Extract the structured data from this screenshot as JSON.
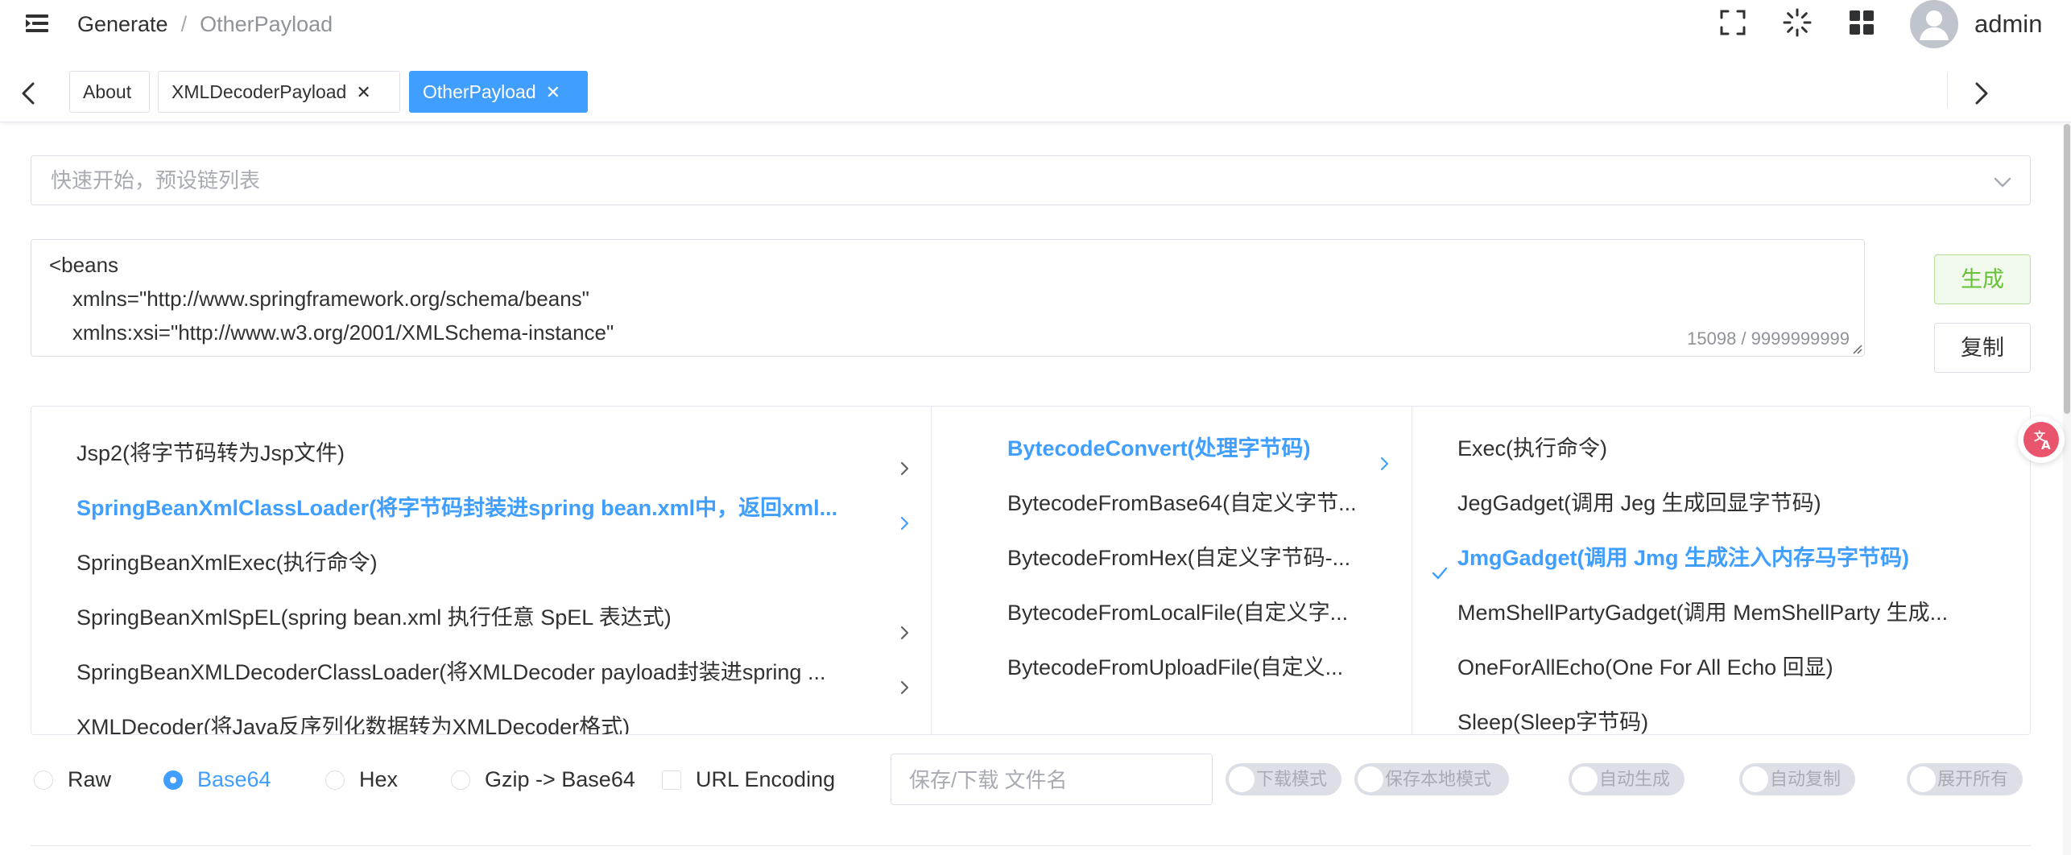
{
  "header": {
    "breadcrumb": [
      "Generate",
      "OtherPayload"
    ],
    "breadcrumb_separator": "/",
    "username": "admin",
    "icons": [
      "hamburger-icon",
      "fullscreen-icon",
      "loading-icon",
      "grid-icon",
      "avatar"
    ]
  },
  "tags": [
    {
      "label": "About",
      "closable": false,
      "active": false
    },
    {
      "label": "XMLDecoderPayload",
      "closable": true,
      "active": false
    },
    {
      "label": "OtherPayload",
      "closable": true,
      "active": true
    }
  ],
  "quick_start": {
    "placeholder": "快速开始，预设链列表"
  },
  "payload": {
    "text": "<beans\n    xmlns=\"http://www.springframework.org/schema/beans\"\n    xmlns:xsi=\"http://www.w3.org/2001/XMLSchema-instance\"",
    "count": "15098 / 9999999999"
  },
  "buttons": {
    "generate": "生成",
    "copy": "复制"
  },
  "cascader": {
    "col1": [
      {
        "label": "Jsp2(将字节码转为Jsp文件)",
        "has_children": true,
        "active": false
      },
      {
        "label": "SpringBeanXmlClassLoader(将字节码封装进spring bean.xml中，返回xml...",
        "has_children": true,
        "active": true
      },
      {
        "label": "SpringBeanXmlExec(执行命令)",
        "has_children": false,
        "active": false
      },
      {
        "label": "SpringBeanXmlSpEL(spring bean.xml 执行任意 SpEL 表达式)",
        "has_children": true,
        "active": false
      },
      {
        "label": "SpringBeanXMLDecoderClassLoader(将XMLDecoder payload封装进spring ...",
        "has_children": true,
        "active": false
      },
      {
        "label": "XMLDecoder(将Java反序列化数据转为XMLDecoder格式)",
        "has_children": true,
        "active": false
      }
    ],
    "col2": [
      {
        "label": "BytecodeConvert(处理字节码)",
        "has_children": true,
        "active": true
      },
      {
        "label": "BytecodeFromBase64(自定义字节...",
        "has_children": false,
        "active": false
      },
      {
        "label": "BytecodeFromHex(自定义字节码-...",
        "has_children": false,
        "active": false
      },
      {
        "label": "BytecodeFromLocalFile(自定义字...",
        "has_children": false,
        "active": false
      },
      {
        "label": "BytecodeFromUploadFile(自定义...",
        "has_children": false,
        "active": false
      }
    ],
    "col3": [
      {
        "label": "Exec(执行命令)",
        "selected": false
      },
      {
        "label": "JegGadget(调用 Jeg 生成回显字节码)",
        "selected": false
      },
      {
        "label": "JmgGadget(调用 Jmg 生成注入内存马字节码)",
        "selected": true
      },
      {
        "label": "MemShellPartyGadget(调用 MemShellParty 生成...",
        "selected": false
      },
      {
        "label": "OneForAllEcho(One For All Echo 回显)",
        "selected": false
      },
      {
        "label": "Sleep(Sleep字节码)",
        "selected": false
      }
    ]
  },
  "encoding": {
    "options": [
      "Raw",
      "Base64",
      "Hex",
      "Gzip -> Base64"
    ],
    "selected": "Base64",
    "url_encoding_label": "URL Encoding",
    "url_encoding_checked": false
  },
  "filename": {
    "placeholder": "保存/下载 文件名"
  },
  "switches": [
    {
      "label": "下载模式",
      "on": false
    },
    {
      "label": "保存本地模式",
      "on": false
    },
    {
      "label": "自动生成",
      "on": false
    },
    {
      "label": "自动复制",
      "on": false
    },
    {
      "label": "展开所有",
      "on": false
    }
  ],
  "colors": {
    "primary": "#409eff",
    "success": "#67c23a",
    "text": "#303133",
    "placeholder": "#a8abb2",
    "border": "#dcdfe6",
    "fab": "#e8556d"
  }
}
